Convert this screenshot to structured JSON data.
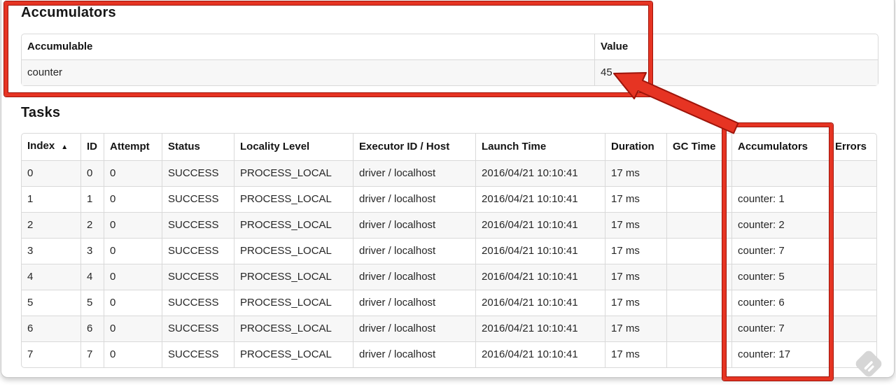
{
  "theme": {
    "annotation_red": "#e63423",
    "annotation_red_dark": "#9e140a"
  },
  "accumulators_section": {
    "title": "Accumulators",
    "table": {
      "headers": [
        "Accumulable",
        "Value"
      ],
      "rows": [
        {
          "accumulable": "counter",
          "value": "45"
        }
      ]
    }
  },
  "tasks_section": {
    "title": "Tasks",
    "table": {
      "sort_icon": "▲",
      "headers": {
        "index": "Index",
        "id": "ID",
        "attempt": "Attempt",
        "status": "Status",
        "locality": "Locality Level",
        "executor": "Executor ID / Host",
        "launch": "Launch Time",
        "duration": "Duration",
        "gc_time": "GC Time",
        "accumulators": "Accumulators",
        "errors": "Errors"
      },
      "rows": [
        {
          "index": "0",
          "id": "0",
          "attempt": "0",
          "status": "SUCCESS",
          "locality": "PROCESS_LOCAL",
          "executor": "driver / localhost",
          "launch": "2016/04/21 10:10:41",
          "duration": "17 ms",
          "gc_time": "",
          "accumulators": "",
          "errors": ""
        },
        {
          "index": "1",
          "id": "1",
          "attempt": "0",
          "status": "SUCCESS",
          "locality": "PROCESS_LOCAL",
          "executor": "driver / localhost",
          "launch": "2016/04/21 10:10:41",
          "duration": "17 ms",
          "gc_time": "",
          "accumulators": "counter: 1",
          "errors": ""
        },
        {
          "index": "2",
          "id": "2",
          "attempt": "0",
          "status": "SUCCESS",
          "locality": "PROCESS_LOCAL",
          "executor": "driver / localhost",
          "launch": "2016/04/21 10:10:41",
          "duration": "17 ms",
          "gc_time": "",
          "accumulators": "counter: 2",
          "errors": ""
        },
        {
          "index": "3",
          "id": "3",
          "attempt": "0",
          "status": "SUCCESS",
          "locality": "PROCESS_LOCAL",
          "executor": "driver / localhost",
          "launch": "2016/04/21 10:10:41",
          "duration": "17 ms",
          "gc_time": "",
          "accumulators": "counter: 7",
          "errors": ""
        },
        {
          "index": "4",
          "id": "4",
          "attempt": "0",
          "status": "SUCCESS",
          "locality": "PROCESS_LOCAL",
          "executor": "driver / localhost",
          "launch": "2016/04/21 10:10:41",
          "duration": "17 ms",
          "gc_time": "",
          "accumulators": "counter: 5",
          "errors": ""
        },
        {
          "index": "5",
          "id": "5",
          "attempt": "0",
          "status": "SUCCESS",
          "locality": "PROCESS_LOCAL",
          "executor": "driver / localhost",
          "launch": "2016/04/21 10:10:41",
          "duration": "17 ms",
          "gc_time": "",
          "accumulators": "counter: 6",
          "errors": ""
        },
        {
          "index": "6",
          "id": "6",
          "attempt": "0",
          "status": "SUCCESS",
          "locality": "PROCESS_LOCAL",
          "executor": "driver / localhost",
          "launch": "2016/04/21 10:10:41",
          "duration": "17 ms",
          "gc_time": "",
          "accumulators": "counter: 7",
          "errors": ""
        },
        {
          "index": "7",
          "id": "7",
          "attempt": "0",
          "status": "SUCCESS",
          "locality": "PROCESS_LOCAL",
          "executor": "driver / localhost",
          "launch": "2016/04/21 10:10:41",
          "duration": "17 ms",
          "gc_time": "",
          "accumulators": "counter: 17",
          "errors": ""
        }
      ]
    }
  }
}
